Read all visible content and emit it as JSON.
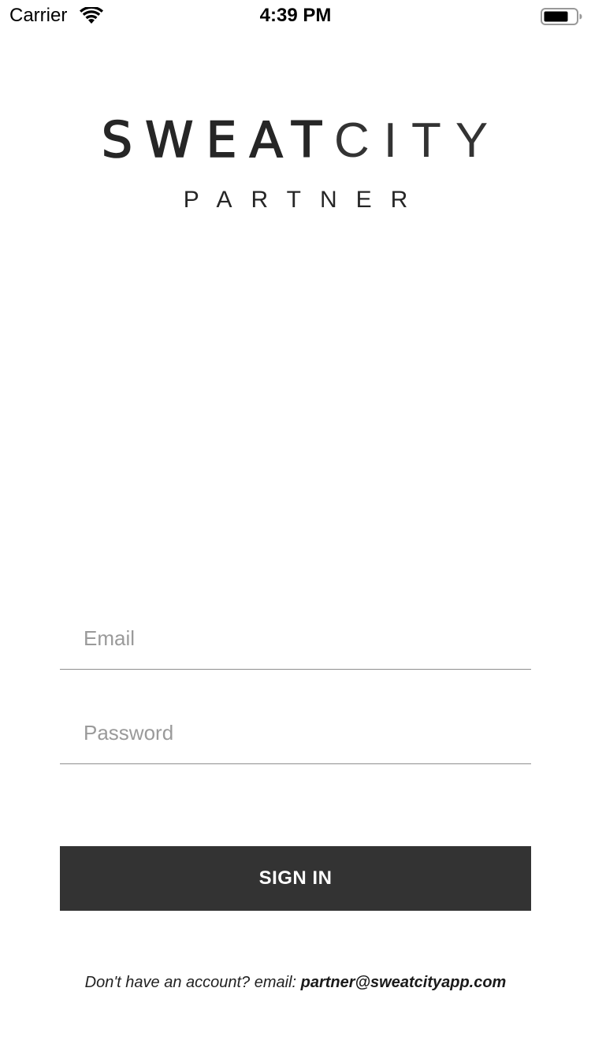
{
  "status_bar": {
    "carrier": "Carrier",
    "time": "4:39 PM",
    "wifi_icon": "wifi-icon",
    "battery_icon": "battery-icon"
  },
  "logo": {
    "word_bold": "SWEAT",
    "word_light": "CITY",
    "subtitle": "PARTNER"
  },
  "form": {
    "email_placeholder": "Email",
    "email_value": "",
    "password_placeholder": "Password",
    "password_value": ""
  },
  "sign_in": {
    "label": "SIGN IN",
    "color": "#333333"
  },
  "footer": {
    "prompt": "Don't have an account? email: ",
    "email": "partner@sweatcityapp.com"
  }
}
